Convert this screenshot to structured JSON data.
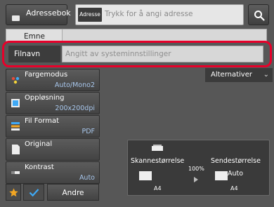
{
  "top_bar": {
    "addressbook_label": "Adressebok",
    "address_tag": "Adresse",
    "address_placeholder": "Trykk for å angi adresse",
    "search_icon": "search-icon"
  },
  "subject": {
    "label": "Emne"
  },
  "filename": {
    "label": "Filnavn",
    "placeholder": "Angitt av systeminnstillinger"
  },
  "options_menu": {
    "label": "Alternativer"
  },
  "settings": [
    {
      "title": "Fargemodus",
      "value": "Auto/Mono2",
      "icon": "color-mode-icon"
    },
    {
      "title": "Oppløsning",
      "value": "200x200dpi",
      "icon": "resolution-icon"
    },
    {
      "title": "Fil Format",
      "value": "PDF",
      "icon": "file-format-icon"
    },
    {
      "title": "Original",
      "value": "",
      "icon": "original-icon"
    },
    {
      "title": "Kontrast",
      "value": "Auto",
      "icon": "contrast-icon"
    }
  ],
  "preview": {
    "scan_size_label": "Skannestørrelse",
    "send_size_label": "Sendestørrelse",
    "send_size_value": "Auto",
    "scan_paper": "A4",
    "send_paper": "A4",
    "ratio": "100%"
  },
  "bottom": {
    "andre_label": "Andre"
  },
  "colors": {
    "highlight": "#e8002a",
    "value_text": "#a8c7ec",
    "star": "#f2a623",
    "check": "#3fa9f5"
  }
}
